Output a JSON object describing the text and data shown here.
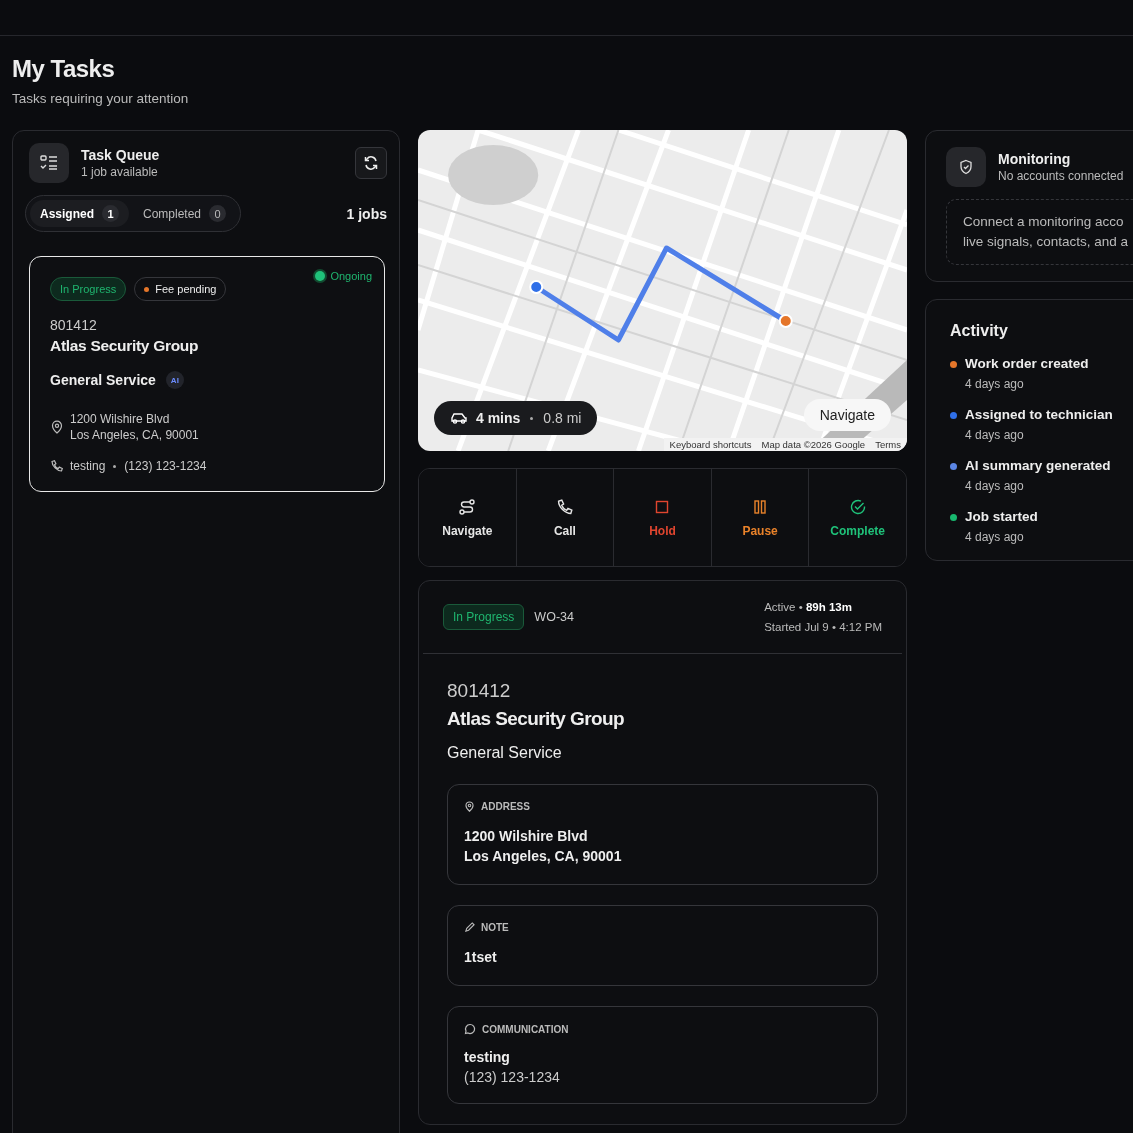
{
  "page": {
    "title": "My Tasks",
    "subtitle": "Tasks requiring your attention"
  },
  "task_queue": {
    "title": "Task Queue",
    "subtitle": "1 job available",
    "job_count": "1 jobs",
    "tabs": [
      {
        "label": "Assigned",
        "count": "1",
        "selected": true
      },
      {
        "label": "Completed",
        "count": "0",
        "selected": false
      }
    ],
    "cards": [
      {
        "selected": true,
        "status": "In Progress",
        "fee": "Fee pending",
        "live": "Ongoing",
        "number": "801412",
        "customer": "Atlas Security Group",
        "service": "General Service",
        "ai_badge": "AI",
        "address_lines": [
          "1200 Wilshire Blvd",
          "Los Angeles, CA, 90001"
        ],
        "contact_name": "testing",
        "contact_phone": "(123) 123-1234"
      }
    ]
  },
  "map": {
    "eta": "4 mins",
    "distance": "0.8 mi",
    "navigate": "Navigate",
    "attribution": [
      "Keyboard shortcuts",
      "Map data ©2026 Google",
      "Terms"
    ]
  },
  "actions": [
    {
      "kind": "navigate",
      "label": "Navigate",
      "color": "#e6e6e6"
    },
    {
      "kind": "call",
      "label": "Call",
      "color": "#e6e6e6"
    },
    {
      "kind": "hold",
      "label": "Hold",
      "color": "#e0452f"
    },
    {
      "kind": "pause",
      "label": "Pause",
      "color": "#e9822a"
    },
    {
      "kind": "complete",
      "label": "Complete",
      "color": "#1fc27a"
    }
  ],
  "detail": {
    "status": "In Progress",
    "work_order": "WO-34",
    "active": "Active • **89h 13m**",
    "started": "Started Jul 9 • 4:12 PM",
    "number": "801412",
    "customer": "Atlas Security Group",
    "service": "General Service",
    "sections": [
      {
        "kind": "address",
        "label": "ADDRESS",
        "lines": [
          "1200 Wilshire Blvd",
          "Los Angeles, CA, 90001"
        ]
      },
      {
        "kind": "note",
        "label": "NOTE",
        "lines": [
          "1tset"
        ]
      },
      {
        "kind": "communication",
        "label": "COMMUNICATION",
        "lines": [
          "testing",
          "(123) 123-1234"
        ]
      }
    ]
  },
  "monitoring": {
    "title": "Monitoring",
    "subtitle": "No accounts connected",
    "message_lines": [
      "Connect a monitoring acco",
      "live signals, contacts, and a"
    ]
  },
  "activity": {
    "title": "Activity",
    "items": [
      {
        "label": "Work order created",
        "time": "4 days ago",
        "color": "#e5762a"
      },
      {
        "label": "Assigned to technician",
        "time": "4 days ago",
        "color": "#2f6fe8"
      },
      {
        "label": "AI summary generated",
        "time": "4 days ago",
        "color": "#5b86e5"
      },
      {
        "label": "Job started",
        "time": "4 days ago",
        "color": "#18b86f"
      }
    ]
  }
}
